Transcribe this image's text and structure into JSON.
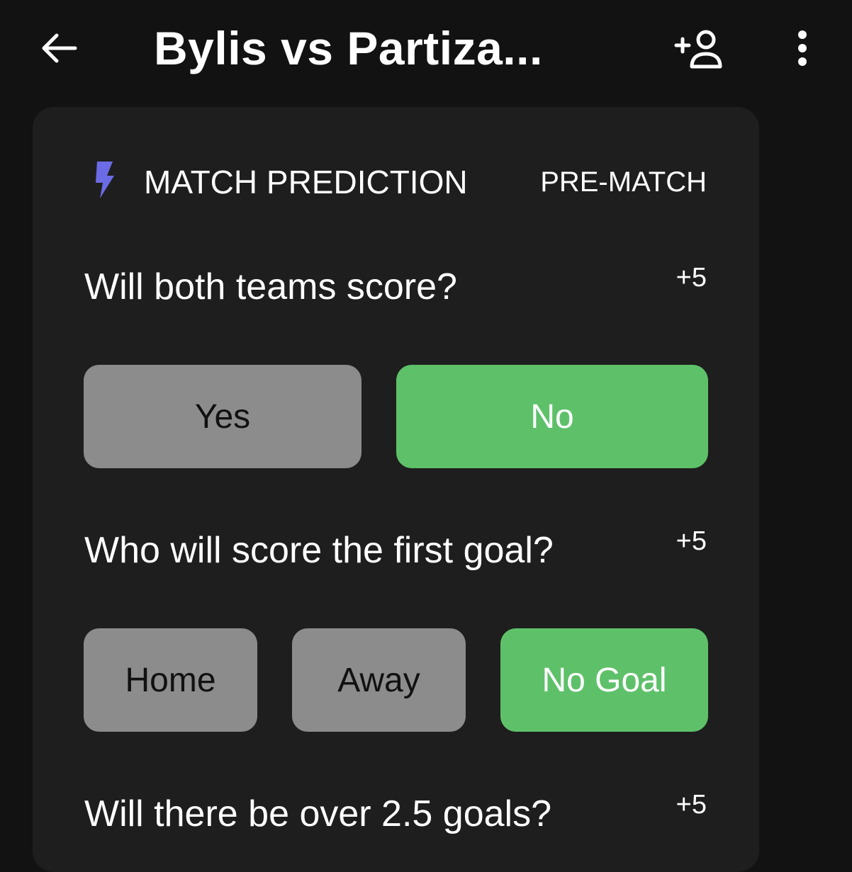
{
  "header": {
    "title": "Bylis vs Partiza...",
    "back_icon": "arrow-left-icon",
    "add_user_icon": "add-person-icon",
    "more_icon": "more-vertical-icon"
  },
  "card": {
    "section_title": "MATCH PREDICTION",
    "section_tag": "PRE-MATCH",
    "section_icon": "lightning-bolt-icon",
    "accent_color": "#6b6be6"
  },
  "questions": [
    {
      "text": "Will both teams score?",
      "points": "+5",
      "options": [
        {
          "label": "Yes",
          "selected": false
        },
        {
          "label": "No",
          "selected": true
        }
      ]
    },
    {
      "text": "Who will score the first goal?",
      "points": "+5",
      "options": [
        {
          "label": "Home",
          "selected": false
        },
        {
          "label": "Away",
          "selected": false
        },
        {
          "label": "No Goal",
          "selected": true
        }
      ]
    },
    {
      "text": "Will there be over 2.5 goals?",
      "points": "+5"
    }
  ],
  "colors": {
    "background": "#121212",
    "card": "#1e1e1e",
    "option_neutral": "#8c8c8c",
    "option_selected": "#5ec16a"
  }
}
